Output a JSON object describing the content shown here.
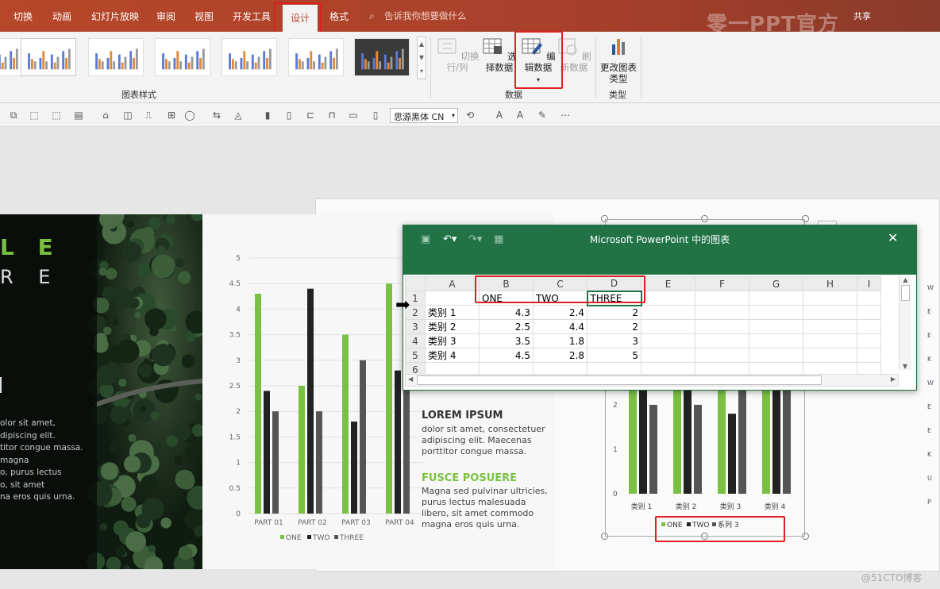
{
  "tabs": [
    "切换",
    "动画",
    "幻灯片放映",
    "审阅",
    "视图",
    "开发工具",
    "设计",
    "格式"
  ],
  "active_tab": "设计",
  "search_placeholder": "告诉我你想要做什么",
  "share_label": "共享",
  "watermark": "零一PPT官方",
  "ribbon": {
    "chart_styles_group": "图表样式",
    "data_group": "数据",
    "type_group": "类型",
    "switch_row_col": "切换行/列",
    "select_data": "选择数据",
    "edit_data": "编辑数据",
    "refresh_data": "刷新数据",
    "change_chart_type": "更改图表类型"
  },
  "font_name": "思源黑体 CN",
  "slide": {
    "title_letters_1": "L E",
    "title_letters_2": "R E",
    "left_para": [
      "olor sit amet,",
      "dipiscing elit.",
      "titor congue massa.",
      "magna",
      "o, purus lectus",
      "o, sit amet",
      "na eros quis urna."
    ],
    "heading1": "LOREM IPSUM",
    "para1": [
      "dolor sit amet, consectetuer",
      "adipiscing elit. Maecenas",
      "porttitor congue massa."
    ],
    "heading2": "FUSCE POSUERE",
    "para2": [
      "Magna sed pulvinar ultricies,",
      "purus lectus malesuada",
      "libero, sit amet commodo",
      "magna eros quis urna."
    ],
    "right_axis_letters": [
      "W",
      "E",
      "E",
      "K",
      "W",
      "E",
      "E",
      "K",
      "U",
      "P"
    ]
  },
  "chart_data": [
    {
      "type": "bar",
      "categories": [
        "PART 01",
        "PART 02",
        "PART 03",
        "PART 04"
      ],
      "series": [
        {
          "name": "ONE",
          "values": [
            4.3,
            2.5,
            3.5,
            4.5
          ]
        },
        {
          "name": "TWO",
          "values": [
            2.4,
            4.4,
            1.8,
            2.8
          ]
        },
        {
          "name": "THREE",
          "values": [
            2,
            2,
            3,
            5
          ]
        }
      ],
      "ylim": [
        0,
        5
      ],
      "yticks": [
        "0",
        "0.5",
        "1",
        "1.5",
        "2",
        "2.5",
        "3",
        "3.5",
        "4",
        "4.5",
        "5"
      ],
      "colors": [
        "#7ac143",
        "#222222",
        "#555555"
      ],
      "legend": "bottom"
    },
    {
      "type": "bar",
      "categories": [
        "类别 1",
        "类别 2",
        "类别 3",
        "类别 4"
      ],
      "series": [
        {
          "name": "ONE",
          "values": [
            4.3,
            2.5,
            3.5,
            4.5
          ]
        },
        {
          "name": "TWO",
          "values": [
            2.4,
            4.4,
            1.8,
            2.8
          ]
        },
        {
          "name": "系列 3",
          "values": [
            2,
            2,
            3,
            5
          ]
        }
      ],
      "yticks": [
        "0",
        "1",
        "2"
      ],
      "colors": [
        "#7ac143",
        "#222222",
        "#555555"
      ],
      "legend": "bottom"
    }
  ],
  "excel": {
    "title": "Microsoft PowerPoint 中的图表",
    "columns": [
      "A",
      "B",
      "C",
      "D",
      "E",
      "F",
      "G",
      "H",
      "I"
    ],
    "rows": [
      {
        "n": "1",
        "a": "",
        "b": "ONE",
        "c": "TWO",
        "d": "THREE"
      },
      {
        "n": "2",
        "a": "类别 1",
        "b": "4.3",
        "c": "2.4",
        "d": "2"
      },
      {
        "n": "3",
        "a": "类别 2",
        "b": "2.5",
        "c": "4.4",
        "d": "2"
      },
      {
        "n": "4",
        "a": "类别 3",
        "b": "3.5",
        "c": "1.8",
        "d": "3"
      },
      {
        "n": "5",
        "a": "类别 4",
        "b": "4.5",
        "c": "2.8",
        "d": "5"
      },
      {
        "n": "6",
        "a": "",
        "b": "",
        "c": "",
        "d": ""
      }
    ]
  },
  "corner_watermark": "@51CTO博客"
}
